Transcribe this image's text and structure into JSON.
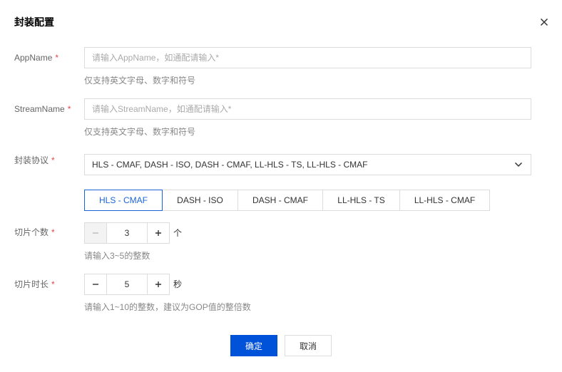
{
  "dialog": {
    "title": "封装配置",
    "close_icon": "close-icon"
  },
  "app_name": {
    "label": "AppName",
    "required_mark": "*",
    "placeholder": "请输入AppName，如通配请输入*",
    "value": "",
    "hint": "仅支持英文字母、数字和符号"
  },
  "stream_name": {
    "label": "StreamName",
    "required_mark": "*",
    "placeholder": "请输入StreamName，如通配请输入*",
    "value": "",
    "hint": "仅支持英文字母、数字和符号"
  },
  "protocol": {
    "label": "封装协议",
    "required_mark": "*",
    "selected": "HLS - CMAF, DASH - ISO, DASH - CMAF, LL-HLS - TS, LL-HLS - CMAF",
    "arrow_icon": "chevron-down-icon",
    "tabs": [
      {
        "label": "HLS - CMAF",
        "active": true
      },
      {
        "label": "DASH - ISO",
        "active": false
      },
      {
        "label": "DASH - CMAF",
        "active": false
      },
      {
        "label": "LL-HLS - TS",
        "active": false
      },
      {
        "label": "LL-HLS - CMAF",
        "active": false
      }
    ]
  },
  "segment_count": {
    "label": "切片个数",
    "required_mark": "*",
    "value": "3",
    "unit": "个",
    "hint": "请输入3~5的整数",
    "decrement_disabled": true
  },
  "segment_duration": {
    "label": "切片时长",
    "required_mark": "*",
    "value": "5",
    "unit": "秒",
    "hint": "请输入1~10的整数，建议为GOP值的整倍数",
    "decrement_disabled": false
  },
  "footer": {
    "ok_label": "确定",
    "cancel_label": "取消"
  },
  "colors": {
    "primary": "#0052d9",
    "required": "#e54545",
    "active_tab": "#1a64d8"
  }
}
